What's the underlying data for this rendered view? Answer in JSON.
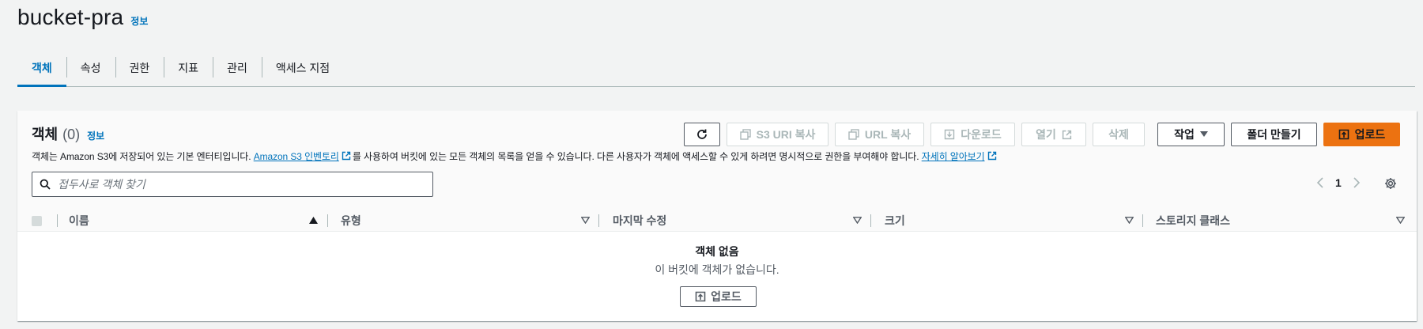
{
  "header": {
    "title": "bucket-pra",
    "info": "정보"
  },
  "tabs": [
    {
      "label": "객체",
      "active": true
    },
    {
      "label": "속성",
      "active": false
    },
    {
      "label": "권한",
      "active": false
    },
    {
      "label": "지표",
      "active": false
    },
    {
      "label": "관리",
      "active": false
    },
    {
      "label": "액세스 지점",
      "active": false
    }
  ],
  "objects": {
    "title": "객체",
    "count": "(0)",
    "info": "정보",
    "description": {
      "part1": "객체는 Amazon S3에 저장되어 있는 기본 엔터티입니다. ",
      "link1": "Amazon S3 인벤토리",
      "part2": "를 사용하여 버킷에 있는 모든 객체의 목록을 얻을 수 있습니다. 다른 사용자가 객체에 액세스할 수 있게 하려면 명시적으로 권한을 부여해야 합니다. ",
      "link2": "자세히 알아보기"
    },
    "toolbar": {
      "refresh_icon": "refresh-icon",
      "copy_s3_uri": "S3 URI 복사",
      "copy_url": "URL 복사",
      "download": "다운로드",
      "open": "열기",
      "delete": "삭제",
      "actions": "작업",
      "create_folder": "폴더 만들기",
      "upload": "업로드"
    },
    "search": {
      "placeholder": "접두사로 객체 찾기"
    },
    "pagination": {
      "page": "1"
    },
    "columns": [
      "이름",
      "유형",
      "마지막 수정",
      "크기",
      "스토리지 클래스"
    ],
    "empty": {
      "title": "객체 없음",
      "description": "이 버킷에 객체가 없습니다.",
      "upload": "업로드"
    }
  },
  "colors": {
    "primary": "#ec7211",
    "link": "#0073bb",
    "background": "#f2f3f3"
  }
}
